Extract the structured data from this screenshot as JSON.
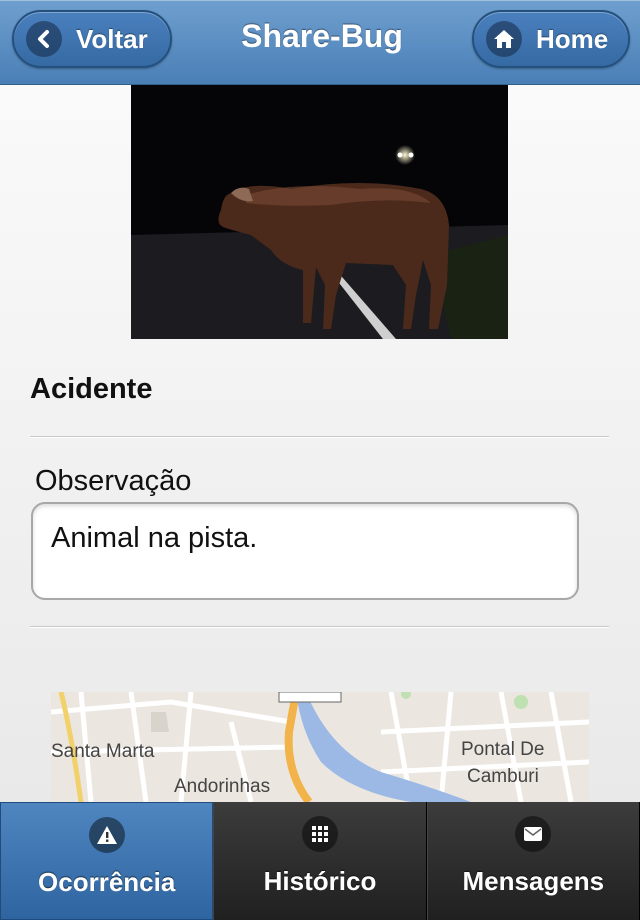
{
  "header": {
    "title": "Share-Bug",
    "back_label": "Voltar",
    "home_label": "Home"
  },
  "occurrence": {
    "type": "Acidente",
    "observation_label": "Observação",
    "observation_value": "Animal na pista."
  },
  "map": {
    "labels": {
      "santa_marta": "Santa Marta",
      "andorinhas": "Andorinhas",
      "pontal": "Pontal De",
      "camburi": "Camburi"
    }
  },
  "tabs": [
    {
      "label": "Ocorrência",
      "icon": "alert-icon",
      "active": true
    },
    {
      "label": "Histórico",
      "icon": "grid-icon",
      "active": false
    },
    {
      "label": "Mensagens",
      "icon": "mail-icon",
      "active": false
    }
  ],
  "colors": {
    "header": "#5a8cc3",
    "active_tab": "#3d74b0",
    "footer": "#262626"
  }
}
